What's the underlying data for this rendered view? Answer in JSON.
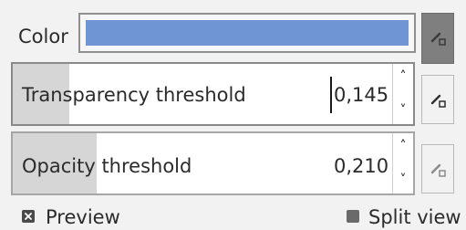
{
  "color_row": {
    "label": "Color",
    "swatch_color": "#6f95d4",
    "picker_icon": "color-picker-icon"
  },
  "transparency": {
    "label": "Transparency threshold",
    "value": "0,145",
    "level": 0.145,
    "up_arrow": "˄",
    "down_arrow": "˅",
    "picker_icon": "color-picker-icon"
  },
  "opacity": {
    "label": "Opacity threshold",
    "value": "0,210",
    "level": 0.21,
    "up_arrow": "˄",
    "down_arrow": "˅",
    "picker_icon": "color-picker-icon"
  },
  "footer": {
    "preview_label": "Preview",
    "preview_checked": true,
    "split_view_label": "Split view",
    "split_view_checked": false
  }
}
